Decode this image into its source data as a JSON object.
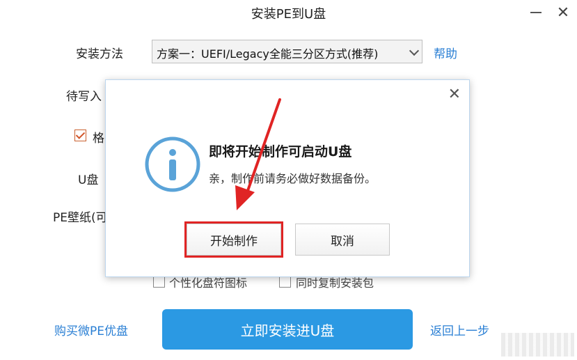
{
  "window": {
    "title": "安装PE到U盘",
    "minimize_icon": "minimize-icon",
    "close_icon": "close-icon"
  },
  "form": {
    "install_method_label": "安装方法",
    "install_method_value": "方案一：UEFI/Legacy全能三分区方式(推荐)",
    "help_link": "帮助",
    "target_disk_label_partial": "待写入",
    "format_label_partial": "格",
    "format_checked": true,
    "usb_label_partial": "U盘",
    "pe_wallpaper_label_partial": "PE壁纸(可",
    "personalize_icon_partial": "个性化盘符图标",
    "copy_package_partial": "同时复制安装包"
  },
  "footer": {
    "buy_link": "购买微PE优盘",
    "install_button": "立即安装进U盘",
    "back_link": "返回上一步"
  },
  "dialog": {
    "title": "即将开始制作可启动U盘",
    "message": "亲，制作前请务必做好数据备份。",
    "start_button": "开始制作",
    "cancel_button": "取消",
    "icon": "info-icon",
    "close_icon": "close-icon"
  },
  "colors": {
    "accent": "#2b99e3",
    "link": "#2a7fd4",
    "annotation": "#e02424",
    "icon_blue": "#5aa3d8"
  }
}
